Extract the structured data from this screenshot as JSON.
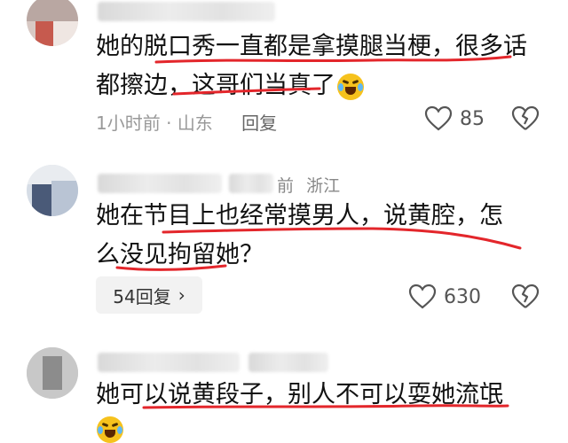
{
  "comments": [
    {
      "text_lines": [
        "她的脱口秀一直都是拿摸腿当梗，很多话",
        "都擦边，这哥们当真了"
      ],
      "time": "1小时前",
      "location": "山东",
      "reply_label": "回复",
      "likes": "85",
      "emoji": "laughing-crying-emoji"
    },
    {
      "meta_suffix": "前",
      "location": "浙江",
      "text_lines": [
        "她在节目上也经常摸男人，说黄腔，怎",
        "么没见拘留她？"
      ],
      "replies_label": "54回复",
      "likes": "630"
    },
    {
      "text_lines": [
        "她可以说黄段子，别人不可以耍她流氓"
      ],
      "emoji": "laughing-crying-emoji"
    }
  ],
  "colors": {
    "underline": "#e3262b",
    "icon": "#555555"
  }
}
